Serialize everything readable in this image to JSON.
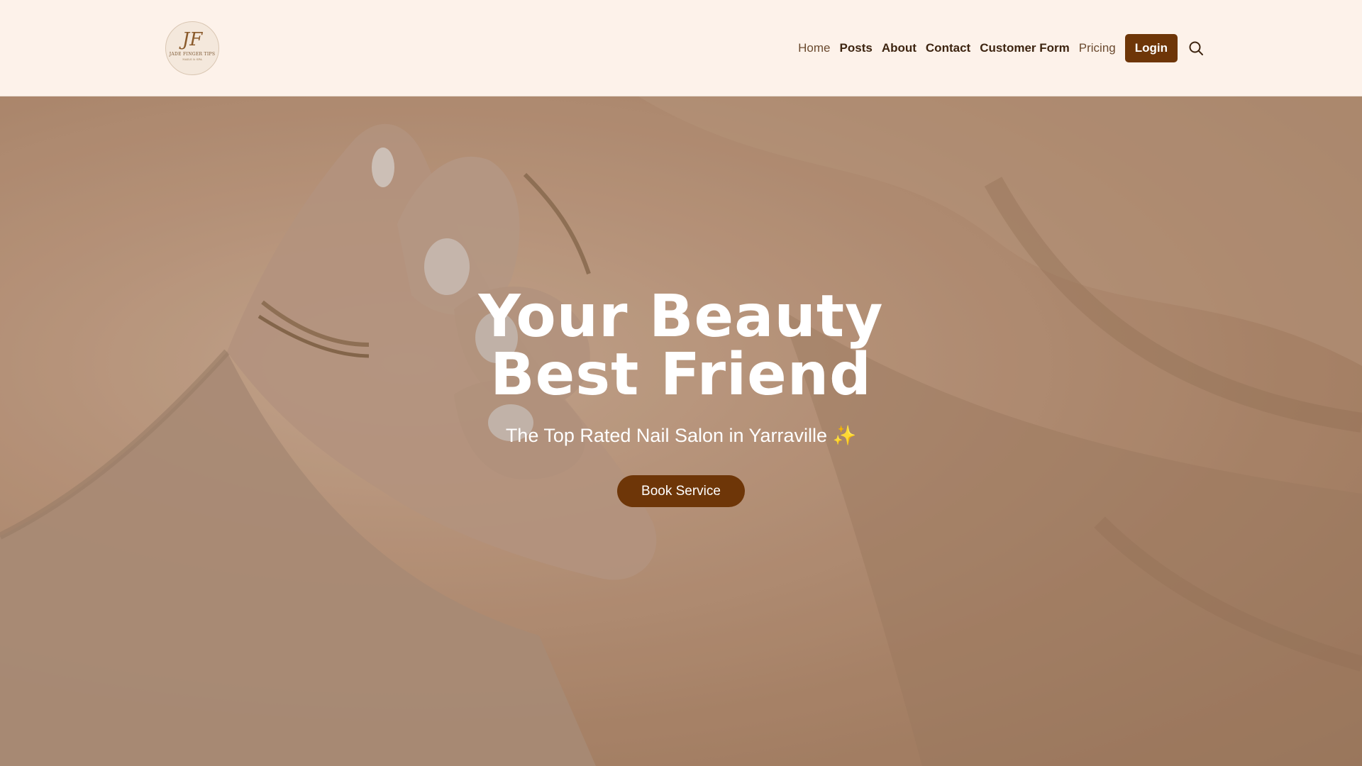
{
  "brand": {
    "logo_monogram": "JF",
    "logo_name": "JADE FINGER TIPS",
    "logo_tagline": "NAILS & SPA"
  },
  "nav": {
    "items": [
      {
        "label": "Home"
      },
      {
        "label": "Posts"
      },
      {
        "label": "About"
      },
      {
        "label": "Contact"
      },
      {
        "label": "Customer Form"
      },
      {
        "label": "Pricing"
      }
    ],
    "login_label": "Login",
    "search_icon": "search-icon"
  },
  "hero": {
    "title": "Your Beauty Best Friend",
    "subtitle": "The Top Rated Nail Salon in Yarraville ✨",
    "cta_label": "Book Service"
  },
  "colors": {
    "header_bg": "#fdf2ea",
    "accent": "#6e3608",
    "nav_text": "#4a2a10"
  }
}
